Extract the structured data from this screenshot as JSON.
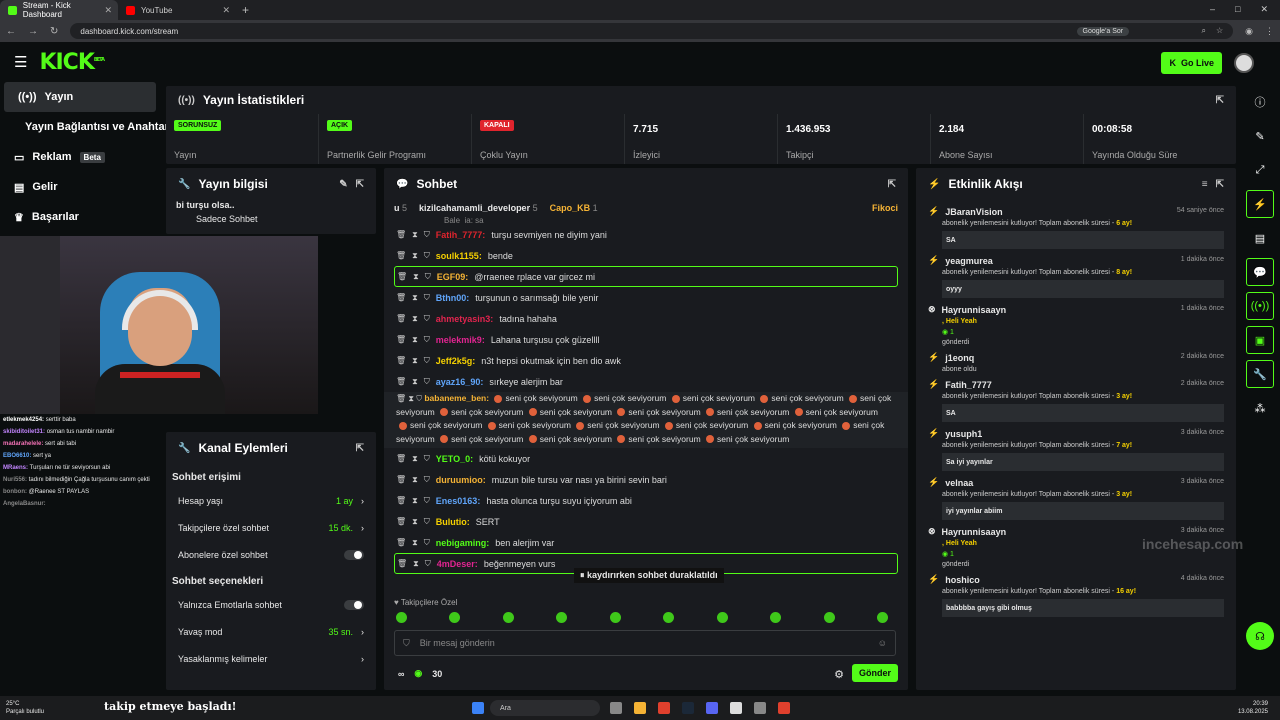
{
  "browser": {
    "tabs": [
      {
        "label": "Stream - Kick Dashboard",
        "favicon_color": "#53fc18"
      },
      {
        "label": "YouTube",
        "favicon_color": "#ff0000"
      }
    ],
    "url": "dashboard.kick.com/stream",
    "google_search_label": "Google'a Sor"
  },
  "topbar": {
    "logo": "KICK",
    "logo_beta": "BETA",
    "golive_label": "Go Live"
  },
  "sidenav": {
    "items": [
      {
        "label": "Yayın",
        "icon": "stream-icon"
      },
      {
        "label": "Yayın Bağlantısı ve Anahtarı",
        "icon": ""
      },
      {
        "label": "Reklam",
        "badge": "Beta",
        "icon": "ad-icon"
      },
      {
        "label": "Gelir",
        "icon": "revenue-icon"
      },
      {
        "label": "Başarılar",
        "icon": "trophy-icon"
      }
    ]
  },
  "stats_panel": {
    "title": "Yayın İstatistikleri",
    "items": [
      {
        "badge": "SORUNSUZ",
        "badge_color": "#53fc18",
        "label": "Yayın"
      },
      {
        "badge": "AÇIK",
        "badge_color": "#53fc18",
        "label": "Partnerlik Gelir Programı"
      },
      {
        "badge": "KAPALI",
        "badge_color": "#e0242d",
        "label": "Çoklu Yayın"
      },
      {
        "value": "7.715",
        "label": "İzleyici"
      },
      {
        "value": "1.436.953",
        "label": "Takipçi"
      },
      {
        "value": "2.184",
        "label": "Abone Sayısı"
      },
      {
        "value": "00:08:58",
        "label": "Yayında Olduğu Süre"
      }
    ]
  },
  "info_panel": {
    "title": "Yayın bilgisi",
    "stream_title": "bi turşu olsa..",
    "category": "Sadece Sohbet"
  },
  "webcam_chat": [
    {
      "user": "etlekmek4254:",
      "text": "serttir baba",
      "color": "#ffffff"
    },
    {
      "user": "skibiditoilet31:",
      "text": "osman tus nambir nambir",
      "color": "#c084fc"
    },
    {
      "user": "madarahelele:",
      "text": "sert abi tabi",
      "color": "#f472b6"
    },
    {
      "user": "EBO6610:",
      "text": "sert ya",
      "color": "#60a5fa"
    },
    {
      "user": "MRaens:",
      "text": "Turşuları ne tür seviyorsun abi",
      "color": "#c084fc"
    },
    {
      "user": "Nuri556:",
      "text": "tadını bilmediğin Çağla turşusunu canım çekti",
      "color": "#888888"
    },
    {
      "user": "bonbon:",
      "text": "@Raenee ST PAYLAS",
      "color": "#888888"
    },
    {
      "user": "AngelaBasnur:",
      "text": "",
      "color": "#888888"
    }
  ],
  "channel_actions": {
    "title": "Kanal Eylemleri",
    "chat_access_title": "Sohbet erişimi",
    "rows": [
      {
        "label": "Hesap yaşı",
        "value": "1 ay",
        "type": "chevron"
      },
      {
        "label": "Takipçilere özel sohbet",
        "value": "15 dk.",
        "type": "chevron"
      },
      {
        "label": "Abonelere özel sohbet",
        "value": "",
        "type": "toggle"
      }
    ],
    "chat_options_title": "Sohbet seçenekleri",
    "rows2": [
      {
        "label": "Yalnızca Emotlarla sohbet",
        "value": "",
        "type": "toggle"
      },
      {
        "label": "Yavaş mod",
        "value": "35 sn.",
        "type": "chevron"
      },
      {
        "label": "Yasaklanmış kelimeler",
        "value": "",
        "type": "chevron"
      }
    ]
  },
  "chat": {
    "title": "Sohbet",
    "top_users": [
      {
        "name": "u",
        "count": "5"
      },
      {
        "name": "kizilcahamamli_developer",
        "count": "5"
      },
      {
        "name": "Capo_KB",
        "count": "1"
      },
      {
        "name": "Fikoci",
        "count": ""
      }
    ],
    "partial_top": "Bale_ia: sa",
    "messages": [
      {
        "user": "Fatih_7777:",
        "text": "turşu sevmiyen ne diyim yani",
        "color": "#e0242d",
        "hl": false
      },
      {
        "user": "soulk1155:",
        "text": "bende",
        "color": "#f5d000",
        "hl": false
      },
      {
        "user": "EGF09:",
        "text": "@rraenee rplace var gircez mi",
        "color": "#f5b335",
        "hl": true
      },
      {
        "user": "Bthn00:",
        "text": "turşunun o sarımsağı bile yenir",
        "color": "#60a5fa",
        "hl": false
      },
      {
        "user": "ahmetyasin3:",
        "text": "tadına hahaha",
        "color": "#e0244e",
        "hl": false
      },
      {
        "user": "melekmik9:",
        "text": "Lahana turşusu çok güzellll",
        "color": "#e02490",
        "hl": false
      },
      {
        "user": "Jeff2k5g:",
        "text": "n3t hepsi okutmak için ben dio awk",
        "color": "#f5d000",
        "hl": false
      },
      {
        "user": "ayaz16_90:",
        "text": "sırkeye alerjim bar",
        "color": "#60a5fa",
        "hl": false
      }
    ],
    "long_user": "babaneme_ben:",
    "long_text": "seni çok seviyorum",
    "messages2": [
      {
        "user": "YETO_0:",
        "text": "kötü kokuyor",
        "color": "#53fc18",
        "hl": false
      },
      {
        "user": "duruumioo:",
        "text": "muzun bile tursu var nası ya birini sevin bari",
        "color": "#f5b335",
        "hl": false
      },
      {
        "user": "Enes0163:",
        "text": "hasta olunca turşu suyu içiyorum abi",
        "color": "#60a5fa",
        "hl": false
      },
      {
        "user": "Bulutio:",
        "text": "SERT",
        "color": "#f5d000",
        "hl": false
      },
      {
        "user": "nebigaming:",
        "text": "ben alerjim var",
        "color": "#53fc18",
        "hl": false
      },
      {
        "user": "4mDeser:",
        "text": "beğenmeyen vurs",
        "color": "#e02490",
        "hl": true
      }
    ],
    "paused_label": "kaydırırken sohbet duraklatıldı",
    "followers_only": "Takipçilere Özel",
    "input_placeholder": "Bir mesaj gönderin",
    "points": "30",
    "send_label": "Gönder"
  },
  "activity": {
    "title": "Etkinlik Akışı",
    "events": [
      {
        "name": "JBaranVision",
        "time": "54 saniye önce",
        "msg": "abonelik yenilemesini kutluyor! Toplam abonelik süresi - ",
        "months": "6 ay!",
        "box": "SA"
      },
      {
        "name": "yeagmurea",
        "time": "1 dakika önce",
        "msg": "abonelik yenilemesini kutluyor! Toplam abonelik süresi - ",
        "months": "8 ay!",
        "box": "oyyy"
      },
      {
        "name": "Hayrunnisaayn",
        "time": "1 dakika önce",
        "msg": ", Heli Yeah",
        "months": "1",
        "box": "gönderdi"
      },
      {
        "name": "j1eonq",
        "time": "2 dakika önce",
        "msg": "abone oldu",
        "months": "",
        "box": ""
      },
      {
        "name": "Fatih_7777",
        "time": "2 dakika önce",
        "msg": "abonelik yenilemesini kutluyor! Toplam abonelik süresi - ",
        "months": "3 ay!",
        "box": "SA"
      },
      {
        "name": "yusuph1",
        "time": "3 dakika önce",
        "msg": "abonelik yenilemesini kutluyor! Toplam abonelik süresi - ",
        "months": "7 ay!",
        "box": "Sa iyi yayınlar"
      },
      {
        "name": "velnaa",
        "time": "3 dakika önce",
        "msg": "abonelik yenilemesini kutluyor! Toplam abonelik süresi - ",
        "months": "3 ay!",
        "box": "iyi yayınlar abiim"
      },
      {
        "name": "Hayrunnisaayn",
        "time": "3 dakika önce",
        "msg": ", Heli Yeah",
        "months": "1",
        "box": "gönderdi"
      },
      {
        "name": "hoshico",
        "time": "4 dakika önce",
        "msg": "abonelik yenilemesini kutluyor! Toplam abonelik süresi - ",
        "months": "16 ay!",
        "box": "babbbba gayış gibi olmuş"
      }
    ]
  },
  "taskbar": {
    "weather": "25°C",
    "weather_desc": "Parçalı bulutlu",
    "search": "Ara",
    "time": "20:39",
    "date": "13.08.2025"
  },
  "overlay": {
    "follow_text": "takip etmeye başladı!"
  },
  "watermark": "incehesap.com"
}
